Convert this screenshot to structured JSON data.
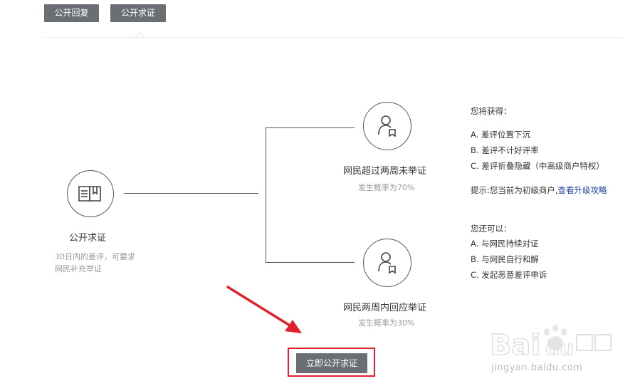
{
  "tabs": [
    {
      "label": "公开回复"
    },
    {
      "label": "公开求证"
    }
  ],
  "left_node": {
    "title": "公开求证",
    "description": "30日内的差评，可要求网民补充举证"
  },
  "top_node": {
    "title": "网民超过两周未举证",
    "probability": "发生概率为70%"
  },
  "bottom_node": {
    "title": "网民两周内回应举证",
    "probability": "发生概率为30%"
  },
  "gain_info": {
    "heading": "您将获得：",
    "items": [
      "A. 差评位置下沉",
      "B. 差评不计好评率",
      "C. 差评折叠隐藏（中高级商户特权）"
    ],
    "tip_prefix": "提示:您当前为初级商户,",
    "tip_link": "查看升级攻略"
  },
  "also_info": {
    "heading": "您还可以：",
    "items": [
      "A. 与网民持续对证",
      "B. 与网民自行和解",
      "C. 发起恶意差评申诉"
    ]
  },
  "cta": {
    "label": "立即公开求证"
  },
  "watermark": {
    "url": "jingyan.baidu.com"
  },
  "colors": {
    "tab_bg": "#6b6e73",
    "link": "#1a3fa0",
    "highlight": "#e0202a"
  }
}
